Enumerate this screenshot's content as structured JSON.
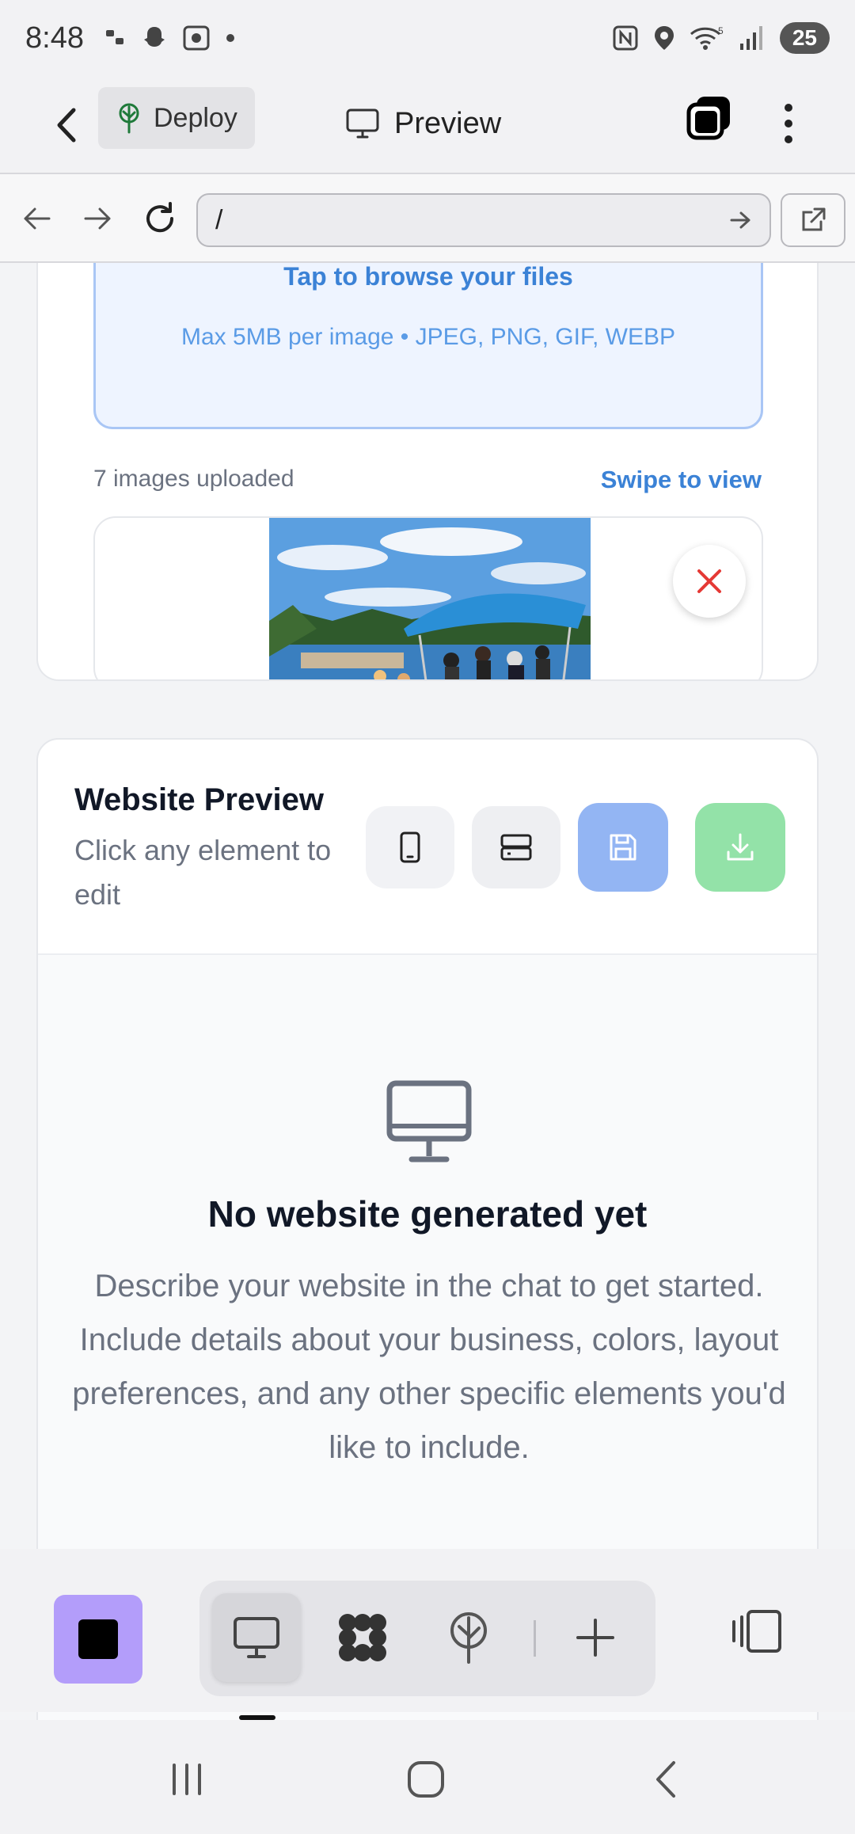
{
  "status_bar": {
    "time": "8:48",
    "battery": "25",
    "wifi_label": "5"
  },
  "app_bar": {
    "deploy_label": "Deploy",
    "preview_title": "Preview"
  },
  "url_bar": {
    "url": "/"
  },
  "upload": {
    "browse_text": "Tap to browse your files",
    "limits_text": "Max 5MB per image • JPEG, PNG, GIF, WEBP",
    "count_text": "7 images uploaded",
    "swipe_text": "Swipe to view"
  },
  "website_preview": {
    "title": "Website Preview",
    "subtitle": "Click any element to edit",
    "empty_title": "No website generated yet",
    "empty_description": "Describe your website in the chat to get started. Include details about your business, colors, layout preferences, and any other specific elements you'd like to include."
  },
  "colors": {
    "accent_blue": "#3b82d6",
    "save_button": "#93b5f3",
    "download_button": "#93e2a8",
    "project_button": "#b39dfa",
    "remove_red": "#e53935"
  },
  "icons": {
    "back": "chevron-left-icon",
    "deploy": "tree-icon",
    "preview": "monitor-icon",
    "tabs": "tabs-icon",
    "more": "more-vertical-icon",
    "reload": "refresh-icon",
    "external": "external-link-icon",
    "mobile": "smartphone-icon",
    "tablet": "tablet-icon",
    "save": "save-icon",
    "download": "download-icon",
    "empty": "monitor-icon"
  }
}
